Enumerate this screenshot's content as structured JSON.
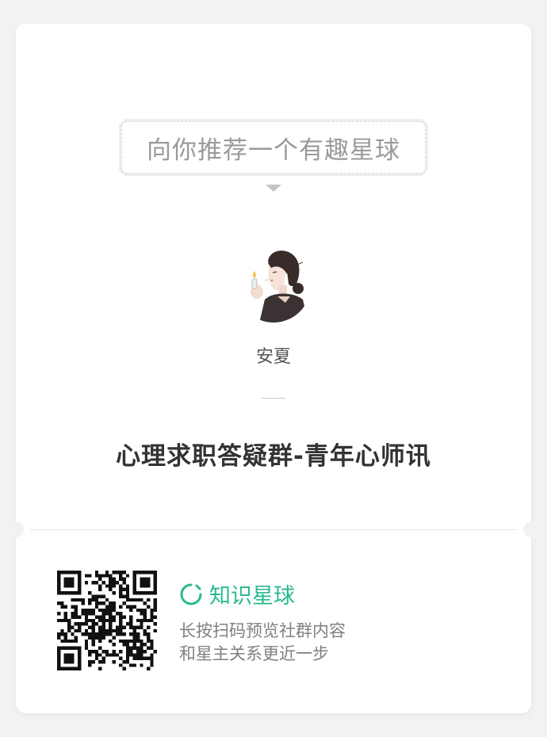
{
  "banner": {
    "text": "向你推荐一个有趣星球"
  },
  "owner": {
    "name": "安夏"
  },
  "group": {
    "title": "心理求职答疑群-青年心师讯"
  },
  "brand": {
    "name": "知识星球",
    "icon": "planet-ring-icon",
    "color": "#2bb992"
  },
  "hint": {
    "line1": "长按扫码预览社群内容",
    "line2": "和星主关系更近一步"
  },
  "qr": {
    "icon": "qr-code"
  }
}
